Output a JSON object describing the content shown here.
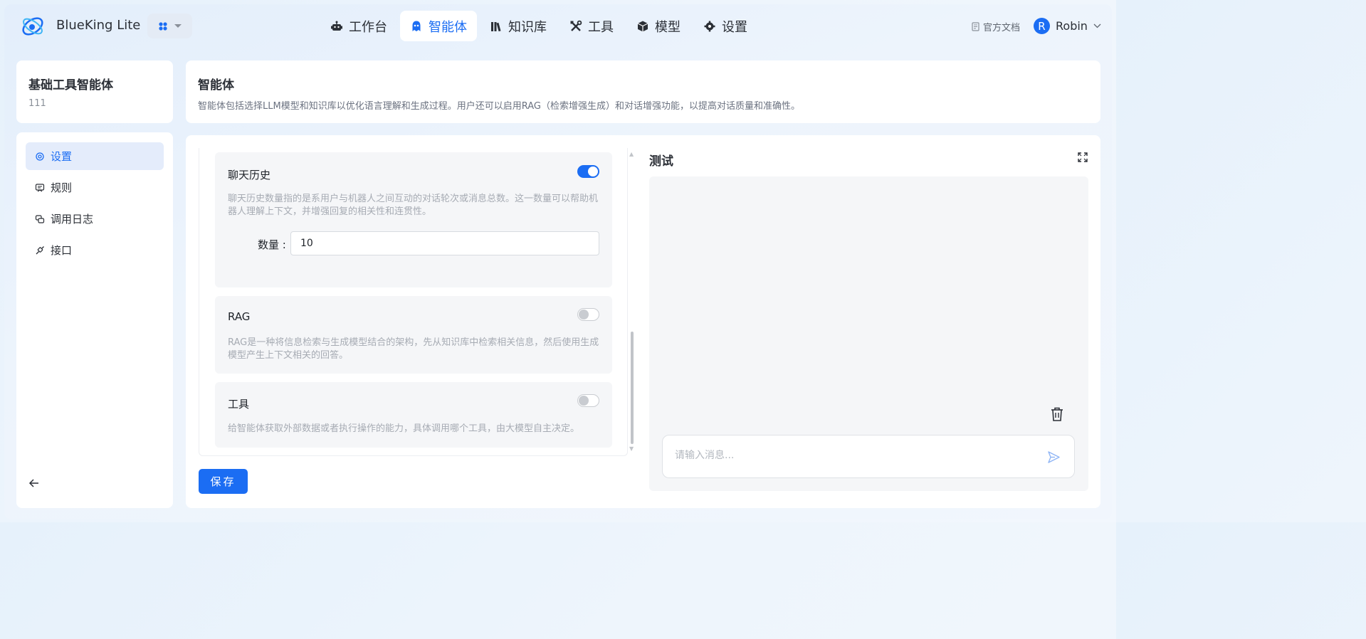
{
  "header": {
    "brand": "BlueKing Lite",
    "nav": [
      {
        "label": "工作台",
        "icon": "robot-icon",
        "active": false
      },
      {
        "label": "智能体",
        "icon": "ghost-icon",
        "active": true
      },
      {
        "label": "知识库",
        "icon": "books-icon",
        "active": false
      },
      {
        "label": "工具",
        "icon": "tools-icon",
        "active": false
      },
      {
        "label": "模型",
        "icon": "cube-icon",
        "active": false
      },
      {
        "label": "设置",
        "icon": "gear-icon",
        "active": false
      }
    ],
    "docs_label": "官方文档",
    "user": {
      "initial": "R",
      "name": "Robin"
    }
  },
  "agent": {
    "name": "基础工具智能体",
    "id": "111"
  },
  "sidebar": {
    "items": [
      {
        "label": "设置",
        "icon": "settings-icon",
        "active": true
      },
      {
        "label": "规则",
        "icon": "rules-icon",
        "active": false
      },
      {
        "label": "调用日志",
        "icon": "log-icon",
        "active": false
      },
      {
        "label": "接口",
        "icon": "api-icon",
        "active": false
      }
    ]
  },
  "intro": {
    "title": "智能体",
    "description": "智能体包括选择LLM模型和知识库以优化语言理解和生成过程。用户还可以启用RAG（检索增强生成）和对话增强功能，以提高对话质量和准确性。"
  },
  "config": {
    "chat_history": {
      "title": "聊天历史",
      "enabled": true,
      "description": "聊天历史数量指的是系用户与机器人之间互动的对话轮次或消息总数。这一数量可以帮助机器人理解上下文，并增强回复的相关性和连贯性。",
      "quantity_label": "数量 :",
      "quantity_value": "10"
    },
    "rag": {
      "title": "RAG",
      "enabled": false,
      "description": "RAG是一种将信息检索与生成模型结合的架构，先从知识库中检索相关信息，然后使用生成模型产生上下文相关的回答。"
    },
    "tools": {
      "title": "工具",
      "enabled": false,
      "description": "给智能体获取外部数据或者执行操作的能力，具体调用哪个工具，由大模型自主决定。"
    },
    "save_label": "保存"
  },
  "test": {
    "title": "测试",
    "input_placeholder": "请输入消息..."
  },
  "colors": {
    "accent": "#1b6df3",
    "panel": "#f5f6f8"
  }
}
